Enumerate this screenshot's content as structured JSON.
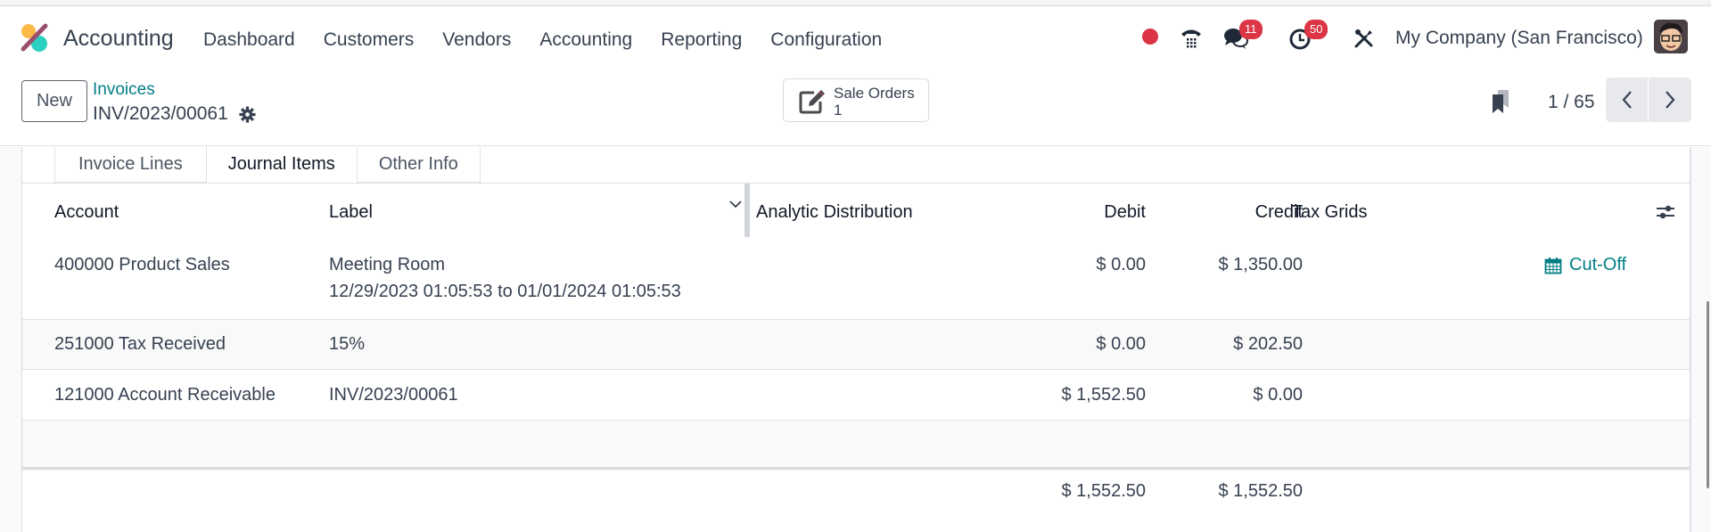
{
  "navbar": {
    "app_name": "Accounting",
    "menu": [
      "Dashboard",
      "Customers",
      "Vendors",
      "Accounting",
      "Reporting",
      "Configuration"
    ],
    "messages_badge": "11",
    "activities_badge": "50",
    "company": "My Company (San Francisco)"
  },
  "control_panel": {
    "new_label": "New",
    "breadcrumb_parent": "Invoices",
    "breadcrumb_current": "INV/2023/00061",
    "smart_button": {
      "label": "Sale Orders",
      "value": "1"
    },
    "pager": "1 / 65"
  },
  "tabs": [
    {
      "label": "Invoice Lines",
      "active": false
    },
    {
      "label": "Journal Items",
      "active": true
    },
    {
      "label": "Other Info",
      "active": false
    }
  ],
  "table": {
    "columns": {
      "account": "Account",
      "label": "Label",
      "analytic": "Analytic Distribution",
      "debit": "Debit",
      "credit": "Credit",
      "tax_grids": "Tax Grids"
    },
    "rows": [
      {
        "account": "400000 Product Sales",
        "label": "Meeting Room",
        "label_line2": "12/29/2023 01:05:53 to 01/01/2024 01:05:53",
        "debit": "$ 0.00",
        "credit": "$ 1,350.00",
        "action": "Cut-Off"
      },
      {
        "account": "251000 Tax Received",
        "label": "15%",
        "debit": "$ 0.00",
        "credit": "$ 202.50"
      },
      {
        "account": "121000 Account Receivable",
        "label": "INV/2023/00061",
        "debit": "$ 1,552.50",
        "credit": "$ 0.00"
      }
    ],
    "totals": {
      "debit": "$ 1,552.50",
      "credit": "$ 1,552.50"
    }
  },
  "colors": {
    "accent": "#017e84",
    "badge": "#dc3545"
  }
}
